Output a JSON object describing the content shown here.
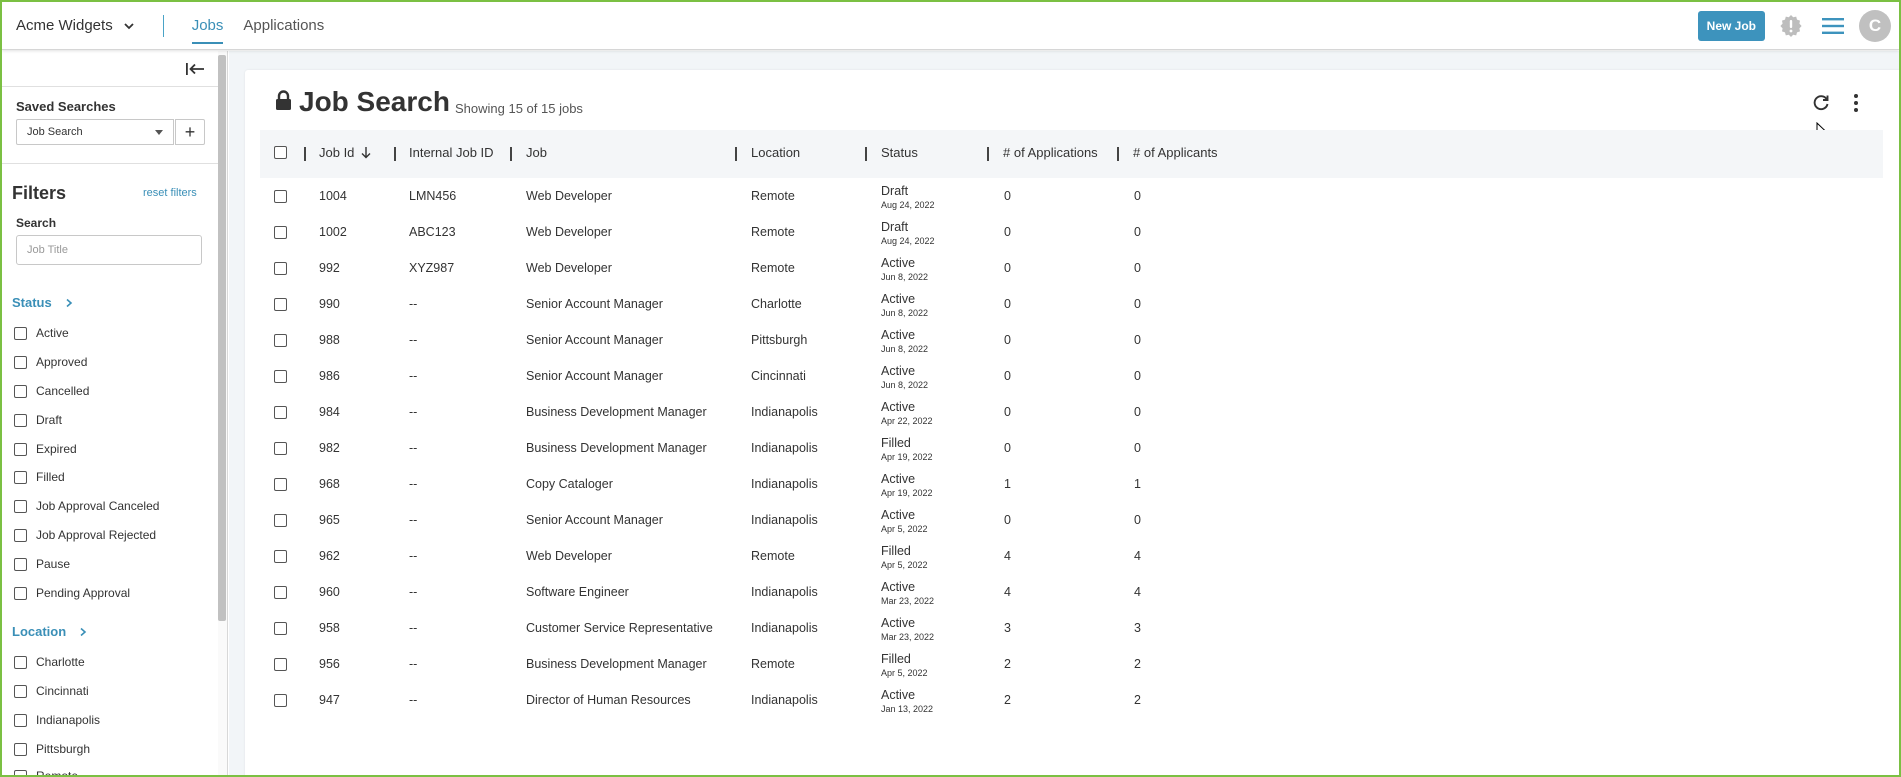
{
  "topbar": {
    "company": "Acme Widgets",
    "tabs": [
      {
        "label": "Jobs",
        "active": true
      },
      {
        "label": "Applications",
        "active": false
      }
    ],
    "new_job_label": "New Job",
    "avatar_initial": "C",
    "accent_color": "#3a8fb7"
  },
  "sidebar": {
    "saved_searches_label": "Saved Searches",
    "saved_search_value": "Job Search",
    "add_label": "+",
    "filters_title": "Filters",
    "reset_filters_label": "reset filters",
    "search_label": "Search",
    "search_placeholder": "Job Title",
    "status_section": "Status",
    "status_options": [
      "Active",
      "Approved",
      "Cancelled",
      "Draft",
      "Expired",
      "Filled",
      "Job Approval Canceled",
      "Job Approval Rejected",
      "Pause",
      "Pending Approval"
    ],
    "location_section": "Location",
    "location_options": [
      "Charlotte",
      "Cincinnati",
      "Indianapolis",
      "Pittsburgh",
      "Remote"
    ]
  },
  "main": {
    "title": "Job Search",
    "showing": "Showing 15 of 15 jobs",
    "columns": [
      "Job Id",
      "Internal Job ID",
      "Job",
      "Location",
      "Status",
      "# of Applications",
      "# of Applicants"
    ],
    "rows": [
      {
        "id": "1004",
        "internal": "LMN456",
        "job": "Web Developer",
        "location": "Remote",
        "status": "Draft",
        "date": "Aug 24, 2022",
        "applications": "0",
        "applicants": "0"
      },
      {
        "id": "1002",
        "internal": "ABC123",
        "job": "Web Developer",
        "location": "Remote",
        "status": "Draft",
        "date": "Aug 24, 2022",
        "applications": "0",
        "applicants": "0"
      },
      {
        "id": "992",
        "internal": "XYZ987",
        "job": "Web Developer",
        "location": "Remote",
        "status": "Active",
        "date": "Jun 8, 2022",
        "applications": "0",
        "applicants": "0"
      },
      {
        "id": "990",
        "internal": "--",
        "job": "Senior Account Manager",
        "location": "Charlotte",
        "status": "Active",
        "date": "Jun 8, 2022",
        "applications": "0",
        "applicants": "0"
      },
      {
        "id": "988",
        "internal": "--",
        "job": "Senior Account Manager",
        "location": "Pittsburgh",
        "status": "Active",
        "date": "Jun 8, 2022",
        "applications": "0",
        "applicants": "0"
      },
      {
        "id": "986",
        "internal": "--",
        "job": "Senior Account Manager",
        "location": "Cincinnati",
        "status": "Active",
        "date": "Jun 8, 2022",
        "applications": "0",
        "applicants": "0"
      },
      {
        "id": "984",
        "internal": "--",
        "job": "Business Development Manager",
        "location": "Indianapolis",
        "status": "Active",
        "date": "Apr 22, 2022",
        "applications": "0",
        "applicants": "0"
      },
      {
        "id": "982",
        "internal": "--",
        "job": "Business Development Manager",
        "location": "Indianapolis",
        "status": "Filled",
        "date": "Apr 19, 2022",
        "applications": "0",
        "applicants": "0"
      },
      {
        "id": "968",
        "internal": "--",
        "job": "Copy Cataloger",
        "location": "Indianapolis",
        "status": "Active",
        "date": "Apr 19, 2022",
        "applications": "1",
        "applicants": "1"
      },
      {
        "id": "965",
        "internal": "--",
        "job": "Senior Account Manager",
        "location": "Indianapolis",
        "status": "Active",
        "date": "Apr 5, 2022",
        "applications": "0",
        "applicants": "0"
      },
      {
        "id": "962",
        "internal": "--",
        "job": "Web Developer",
        "location": "Remote",
        "status": "Filled",
        "date": "Apr 5, 2022",
        "applications": "4",
        "applicants": "4"
      },
      {
        "id": "960",
        "internal": "--",
        "job": "Software Engineer",
        "location": "Indianapolis",
        "status": "Active",
        "date": "Mar 23, 2022",
        "applications": "4",
        "applicants": "4"
      },
      {
        "id": "958",
        "internal": "--",
        "job": "Customer Service Representative",
        "location": "Indianapolis",
        "status": "Active",
        "date": "Mar 23, 2022",
        "applications": "3",
        "applicants": "3"
      },
      {
        "id": "956",
        "internal": "--",
        "job": "Business Development Manager",
        "location": "Remote",
        "status": "Filled",
        "date": "Apr 5, 2022",
        "applications": "2",
        "applicants": "2"
      },
      {
        "id": "947",
        "internal": "--",
        "job": "Director of Human Resources",
        "location": "Indianapolis",
        "status": "Active",
        "date": "Jan 13, 2022",
        "applications": "2",
        "applicants": "2"
      }
    ]
  }
}
